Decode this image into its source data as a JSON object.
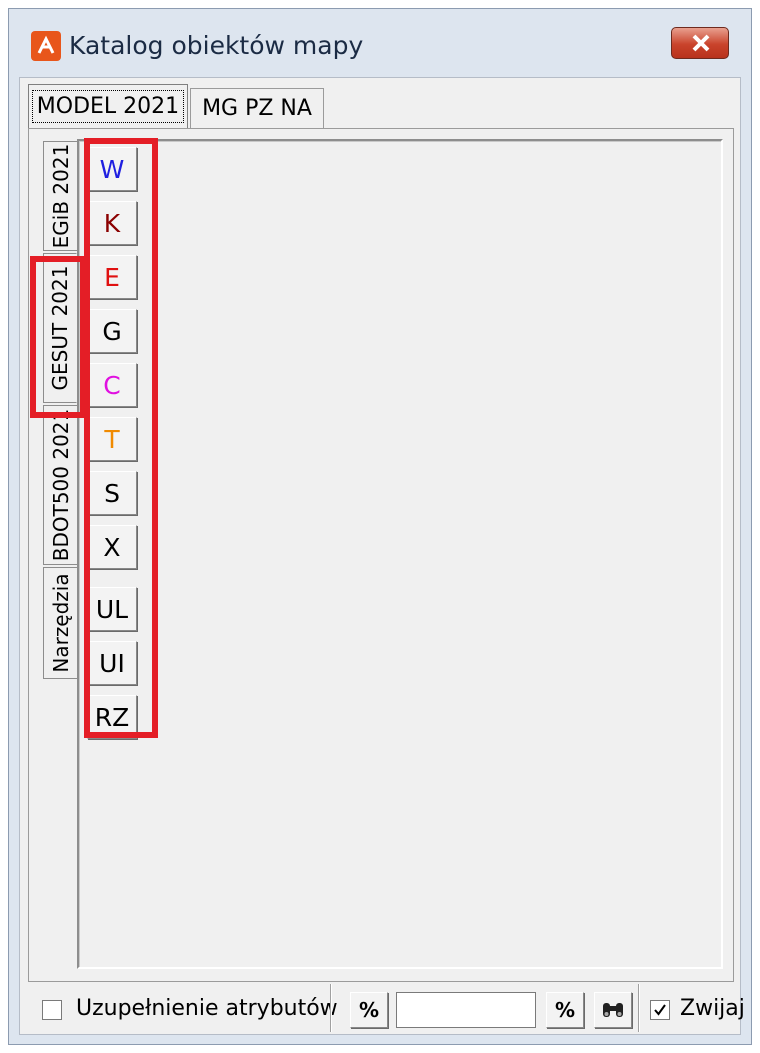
{
  "window": {
    "title": "Katalog obiektów mapy",
    "close_icon": "close-icon"
  },
  "top_tabs": [
    {
      "label": "MODEL 2021",
      "active": true
    },
    {
      "label": "MG PZ NA",
      "active": false
    }
  ],
  "side_tabs": [
    {
      "label": "EGiB 2021",
      "active": false
    },
    {
      "label": "GESUT 2021",
      "active": true
    },
    {
      "label": "BDOT500 2021",
      "active": false
    },
    {
      "label": "Narzędzia",
      "active": false
    }
  ],
  "group_buttons": [
    {
      "label": "W",
      "color": "#1f1fe0"
    },
    {
      "label": "K",
      "color": "#8b0000"
    },
    {
      "label": "E",
      "color": "#e01010"
    },
    {
      "label": "G",
      "color": "#000000"
    },
    {
      "label": "C",
      "color": "#e010e0"
    },
    {
      "label": "T",
      "color": "#f08a00"
    },
    {
      "label": "S",
      "color": "#000000"
    },
    {
      "label": "X",
      "color": "#000000"
    },
    {
      "label": "UL",
      "color": "#000000"
    },
    {
      "label": "UI",
      "color": "#000000"
    },
    {
      "label": "RZ",
      "color": "#000000"
    }
  ],
  "bottom": {
    "fill_attributes_label": "Uzupełnienie atrybutów",
    "fill_attributes_checked": false,
    "percent_left_label": "%",
    "search_value": "",
    "percent_right_label": "%",
    "find_icon": "binoculars-icon",
    "collapse_label": "Zwijaj",
    "collapse_checked": true
  },
  "highlight_color": "#e41e26"
}
